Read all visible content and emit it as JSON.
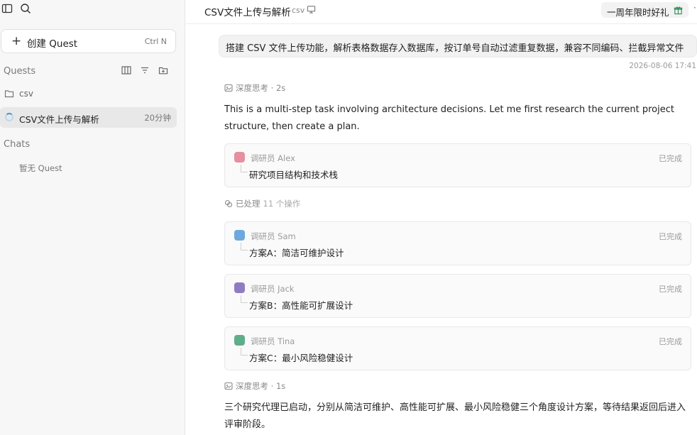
{
  "sidebar": {
    "new_quest_label": "创建 Quest",
    "new_quest_shortcut": "Ctrl N",
    "quests_title": "Quests",
    "folder_name": "csv",
    "active_quest": {
      "title": "CSV文件上传与解析",
      "time": "20分钟"
    },
    "chats_title": "Chats",
    "chats_empty": "暂无 Quest"
  },
  "header": {
    "title": "CSV文件上传与解析",
    "tag": "csv",
    "promo": "一周年限时好礼",
    "more": "·"
  },
  "chat": {
    "user_message": "搭建 CSV 文件上传功能，解析表格数据存入数据库，按订单号自动过滤重复数据，兼容不同编码、拦截异常文件",
    "timestamp": "2026-08-06 17:41",
    "think1": "深度思考 · 2s",
    "para1": "This is a multi-step task involving architecture decisions. Let me first research the current project structure, then create a plan.",
    "agents": [
      {
        "name": "调研员 Alex",
        "status": "已完成",
        "task": "研究项目结构和技术栈",
        "avatar_color": "#e58fa0"
      },
      {
        "name": "调研员 Sam",
        "status": "已完成",
        "task": "方案A：简洁可维护设计",
        "avatar_color": "#6fa8dc"
      },
      {
        "name": "调研员 Jack",
        "status": "已完成",
        "task": "方案B：高性能可扩展设计",
        "avatar_color": "#8e7cc3"
      },
      {
        "name": "调研员 Tina",
        "status": "已完成",
        "task": "方案C：最小风险稳健设计",
        "avatar_color": "#5fae8b"
      }
    ],
    "processed_label": "已处理",
    "processed_count": "11 个操作",
    "think2": "深度思考 · 1s",
    "para2": "三个研究代理已启动，分别从简洁可维护、高性能可扩展、最小风险稳健三个角度设计方案，等待结果返回后进入评审阶段。"
  },
  "icons": {
    "sidebar_toggle": "sidebar-toggle-icon",
    "search": "search-icon",
    "plus": "plus-icon",
    "columns": "columns-icon",
    "filter": "filter-icon",
    "new_folder": "new-folder-icon",
    "folder": "folder-icon",
    "spinner": "spinner-icon",
    "monitor": "monitor-icon",
    "gift": "gift-icon",
    "think": "think-icon",
    "processed": "processed-icon"
  }
}
